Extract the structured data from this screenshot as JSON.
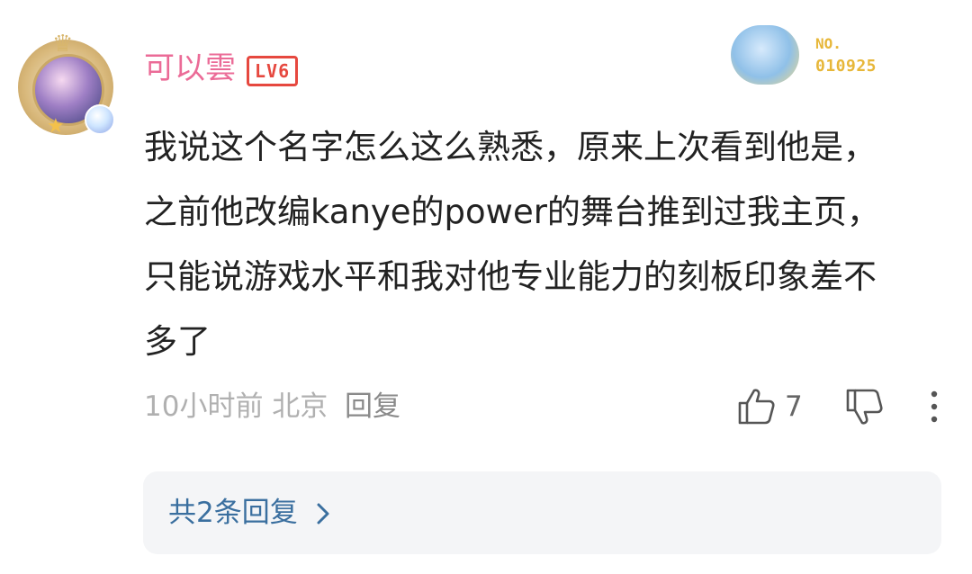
{
  "user": {
    "name": "可以雲",
    "level_badge": "LV6",
    "fan_badge": {
      "label": "NO.",
      "number": "010925"
    }
  },
  "comment": {
    "lines": [
      "我说这个名字怎么这么熟悉，原来上次看到他是，",
      "之前他改编kanye的power的舞台推到过我主页，",
      "只能说游戏水平和我对他专业能力的刻板印象差不",
      "多了"
    ]
  },
  "meta": {
    "time_location": "10小时前 北京",
    "reply_label": "回复",
    "like_count": "7"
  },
  "replies": {
    "label": "共2条回复"
  },
  "icons": {
    "like": "thumbs-up-icon",
    "dislike": "thumbs-down-icon",
    "more": "more-vertical-icon",
    "chevron": "chevron-right-icon"
  },
  "colors": {
    "username": "#eb6b97",
    "level_badge": "#e6483f",
    "fan_badge": "#e7b739",
    "reply_link": "#3a6f9f"
  }
}
